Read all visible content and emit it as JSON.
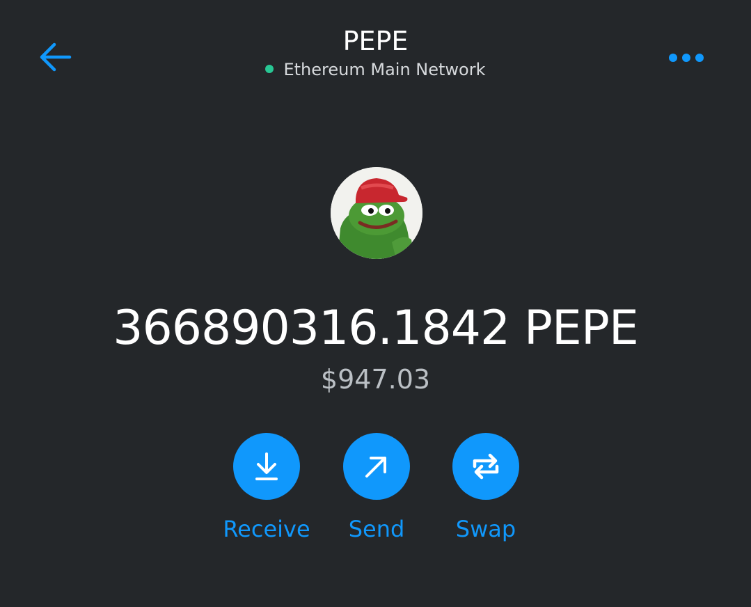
{
  "header": {
    "title": "PEPE",
    "network": "Ethereum Main Network",
    "back_icon": "arrow-left-icon",
    "more_icon": "more-dots-icon"
  },
  "token": {
    "avatar_icon": "pepe-token-icon",
    "balance": "366890316.1842 PEPE",
    "fiat_value": "$947.03"
  },
  "actions": [
    {
      "label": "Receive",
      "icon": "download-icon"
    },
    {
      "label": "Send",
      "icon": "arrow-up-right-icon"
    },
    {
      "label": "Swap",
      "icon": "swap-icon"
    }
  ],
  "colors": {
    "background": "#24272a",
    "accent": "#1098fc",
    "network_dot": "#28c794",
    "text_primary": "#ffffff",
    "text_secondary": "#bbc0c5"
  }
}
